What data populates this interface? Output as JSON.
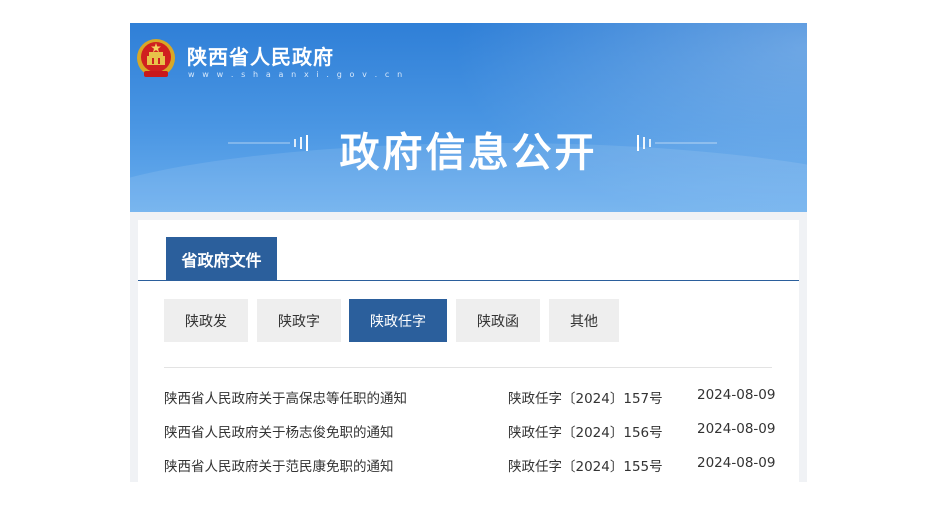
{
  "header": {
    "site_name": "陕西省人民政府",
    "site_url": "w w w . s h a a n x i . g o v . c n",
    "banner_title": "政府信息公开"
  },
  "section": {
    "title": "省政府文件"
  },
  "tabs": [
    {
      "label": "陕政发",
      "active": false
    },
    {
      "label": "陕政字",
      "active": false
    },
    {
      "label": "陕政任字",
      "active": true
    },
    {
      "label": "陕政函",
      "active": false
    },
    {
      "label": "其他",
      "active": false
    }
  ],
  "documents": [
    {
      "title": "陕西省人民政府关于高保忠等任职的通知",
      "doc_no": "陕政任字〔2024〕157号",
      "date": "2024-08-09"
    },
    {
      "title": "陕西省人民政府关于杨志俊免职的通知",
      "doc_no": "陕政任字〔2024〕156号",
      "date": "2024-08-09"
    },
    {
      "title": "陕西省人民政府关于范民康免职的通知",
      "doc_no": "陕政任字〔2024〕155号",
      "date": "2024-08-09"
    }
  ],
  "colors": {
    "primary": "#2b5f9c",
    "banner": "#3a88dc"
  }
}
